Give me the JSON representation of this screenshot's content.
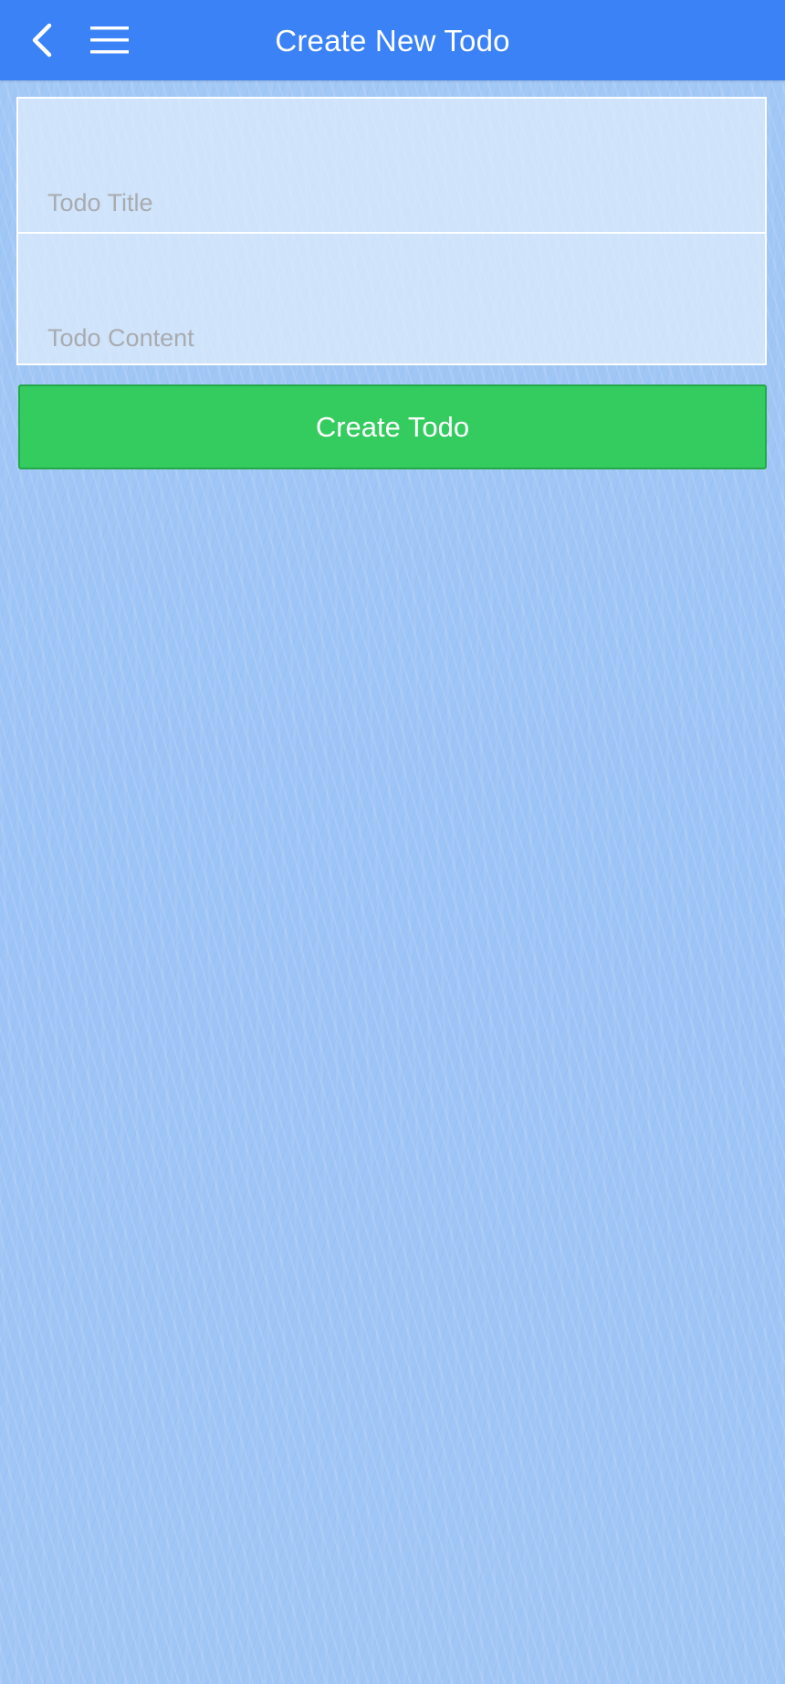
{
  "header": {
    "title": "Create New Todo",
    "back_icon": "chevron-left-icon",
    "menu_icon": "hamburger-menu-icon",
    "background_color": "#3b82f6"
  },
  "form": {
    "title_field": {
      "placeholder": "Todo Title",
      "value": ""
    },
    "content_field": {
      "placeholder": "Todo Content",
      "value": ""
    },
    "submit_label": "Create Todo",
    "submit_color": "#34cc5f"
  }
}
